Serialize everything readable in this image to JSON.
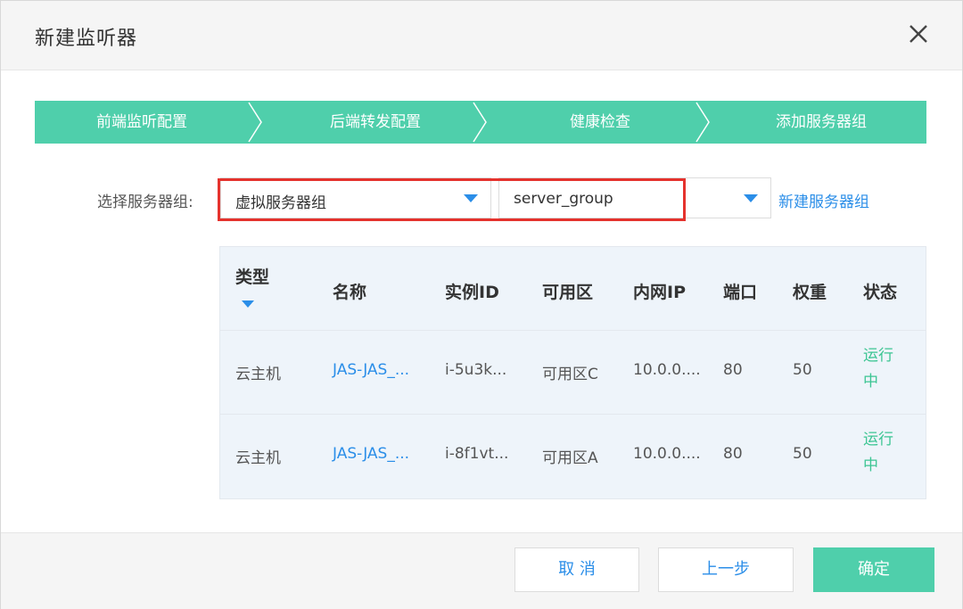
{
  "dialog": {
    "title": "新建监听器",
    "close_icon": "close-icon"
  },
  "steps": [
    {
      "label": "前端监听配置"
    },
    {
      "label": "后端转发配置"
    },
    {
      "label": "健康检查"
    },
    {
      "label": "添加服务器组"
    }
  ],
  "server_group": {
    "label": "选择服务器组:",
    "type_value": "虚拟服务器组",
    "group_value": "server_group",
    "new_link": "新建服务器组"
  },
  "table": {
    "columns": [
      "类型",
      "名称",
      "实例ID",
      "可用区",
      "内网IP",
      "端口",
      "权重",
      "状态"
    ],
    "rows": [
      {
        "type": "云主机",
        "name": "JAS-JAS_...",
        "instance_id": "i-5u3k...",
        "zone": "可用区C",
        "ip": "10.0.0....",
        "port": "80",
        "weight": "50",
        "status_line1": "运行",
        "status_line2": "中"
      },
      {
        "type": "云主机",
        "name": "JAS-JAS_...",
        "instance_id": "i-8f1vt...",
        "zone": "可用区A",
        "ip": "10.0.0....",
        "port": "80",
        "weight": "50",
        "status_line1": "运行",
        "status_line2": "中"
      }
    ]
  },
  "footer": {
    "cancel": "取 消",
    "prev": "上一步",
    "ok": "确定"
  },
  "colors": {
    "accent": "#4fcfab",
    "link": "#2b8ee8",
    "highlight": "#e5322d",
    "status_running": "#3cc593"
  }
}
